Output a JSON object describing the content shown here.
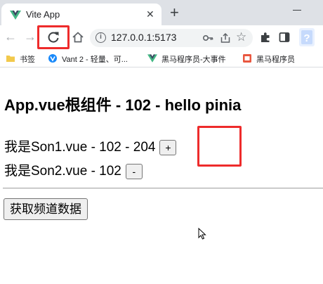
{
  "browser": {
    "tab_title": "Vite App",
    "tab_close": "✕",
    "new_tab": "+",
    "url": "127.0.0.1:5173",
    "nav_back": "←",
    "nav_forward": "→",
    "star": "☆",
    "info": "i",
    "highlight_color": "#ee2b2b"
  },
  "bookmarks": [
    {
      "label": "书签",
      "icon": "folder-icon"
    },
    {
      "label": "Vant 2 - 轻量、可...",
      "icon": "vant-icon"
    },
    {
      "label": "黑马程序员-大事件",
      "icon": "vue-logo-icon"
    },
    {
      "label": "黑马程序员",
      "icon": "heima-icon"
    }
  ],
  "app": {
    "title": "App.vue根组件 - 102 - hello pinia",
    "son1": "我是Son1.vue - 102 - 204",
    "son1_button": "+",
    "son2": "我是Son2.vue - 102",
    "son2_button": "-",
    "fetch_button": "获取频道数据"
  }
}
